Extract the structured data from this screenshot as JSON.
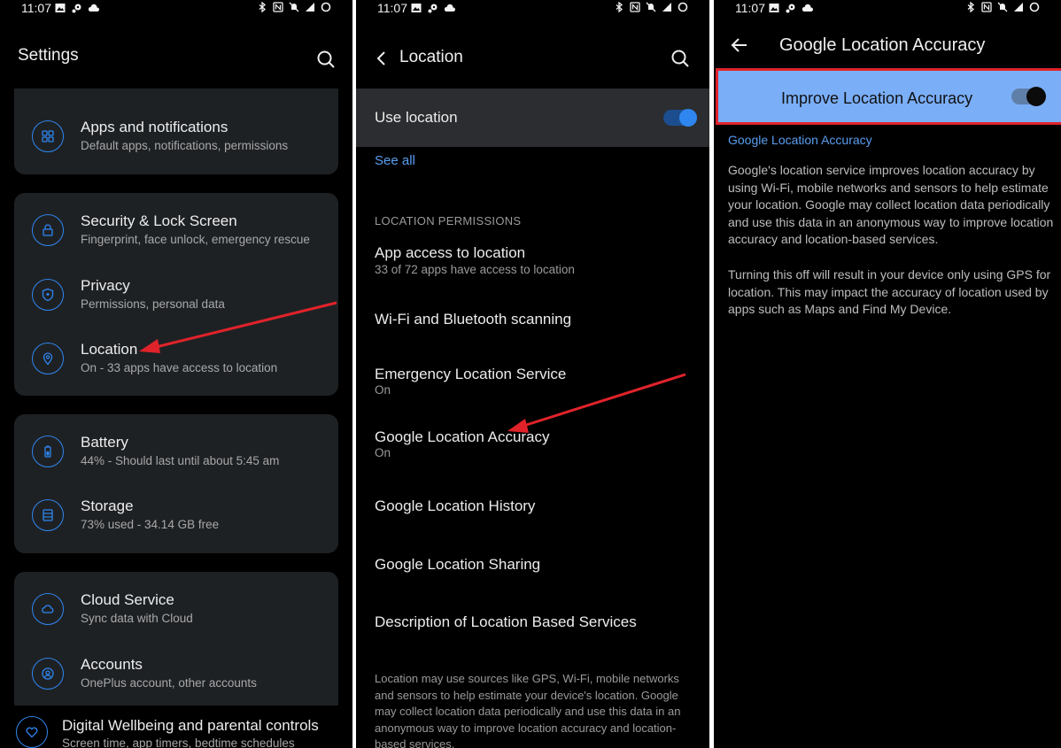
{
  "status": {
    "time": "11:07"
  },
  "panel1": {
    "title": "Settings",
    "items": [
      {
        "title": "Apps and notifications",
        "sub": "Default apps, notifications, permissions"
      },
      {
        "title": "Security & Lock Screen",
        "sub": "Fingerprint, face unlock, emergency rescue"
      },
      {
        "title": "Privacy",
        "sub": "Permissions, personal data"
      },
      {
        "title": "Location",
        "sub": "On - 33 apps have access to location"
      },
      {
        "title": "Battery",
        "sub": "44% - Should last until about 5:45 am"
      },
      {
        "title": "Storage",
        "sub": "73% used - 34.14 GB free"
      },
      {
        "title": "Cloud Service",
        "sub": "Sync data with Cloud"
      },
      {
        "title": "Accounts",
        "sub": "OnePlus account, other accounts"
      },
      {
        "title": "Digital Wellbeing and parental controls",
        "sub": "Screen time, app timers, bedtime schedules"
      }
    ]
  },
  "panel2": {
    "title": "Location",
    "use_location": "Use location",
    "see_all": "See all",
    "section": "LOCATION PERMISSIONS",
    "items": [
      {
        "title": "App access to location",
        "sub": "33 of 72 apps have access to location"
      },
      {
        "title": "Wi-Fi and Bluetooth scanning",
        "sub": ""
      },
      {
        "title": "Emergency Location Service",
        "sub": "On"
      },
      {
        "title": "Google Location Accuracy",
        "sub": "On"
      },
      {
        "title": "Google Location History",
        "sub": ""
      },
      {
        "title": "Google Location Sharing",
        "sub": ""
      },
      {
        "title": "Description of Location Based Services",
        "sub": ""
      }
    ],
    "footer": "Location may use sources like GPS, Wi-Fi, mobile networks and sensors to help estimate your device's location. Google may collect location data periodically and use this data in an anonymous way to improve location accuracy and location-based services."
  },
  "panel3": {
    "title": "Google Location Accuracy",
    "toggle_label": "Improve Location Accuracy",
    "link": "Google Location Accuracy",
    "para1": "Google's location service improves location accuracy by using Wi-Fi, mobile networks and sensors to help estimate your location. Google may collect location data periodically and use this data in an anonymous way to improve location accuracy and location-based services.",
    "para2": "Turning this off will result in your device only using GPS for location. This may impact the accuracy of location used by apps such as Maps and Find My Device."
  },
  "colors": {
    "accent": "#2f86f0",
    "highlight": "#7aaef7",
    "annotation": "#e0232a"
  }
}
